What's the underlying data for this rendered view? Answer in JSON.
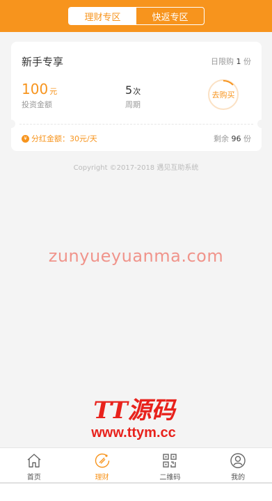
{
  "header": {
    "tabs": [
      {
        "label": "理财专区",
        "active": true
      },
      {
        "label": "快返专区",
        "active": false
      }
    ]
  },
  "product": {
    "title": "新手专享",
    "limit_prefix": "日限购",
    "limit_num": "1",
    "limit_unit": "份",
    "amount_value": "100",
    "amount_unit": "元",
    "amount_label": "投资金额",
    "period_value": "5",
    "period_unit": "次",
    "period_label": "周期",
    "buy_label": "去购买",
    "dividend_icon": "¥",
    "dividend_text": "分红金额：30元/天",
    "remain_prefix": "剩余",
    "remain_num": "96",
    "remain_unit": "份"
  },
  "copyright": "Copyright ©2017-2018 遇见互助系统",
  "watermark": "zunyueyuanma.com",
  "logo": {
    "cn": "TT源码",
    "url": "www.ttym.cc"
  },
  "tabbar": [
    {
      "label": "首页",
      "icon": "home-icon",
      "active": false
    },
    {
      "label": "理财",
      "icon": "finance-icon",
      "active": true
    },
    {
      "label": "二维码",
      "icon": "qrcode-icon",
      "active": false
    },
    {
      "label": "我的",
      "icon": "user-icon",
      "active": false
    }
  ],
  "colors": {
    "accent": "#f7941d",
    "background": "#f4f4f4"
  }
}
